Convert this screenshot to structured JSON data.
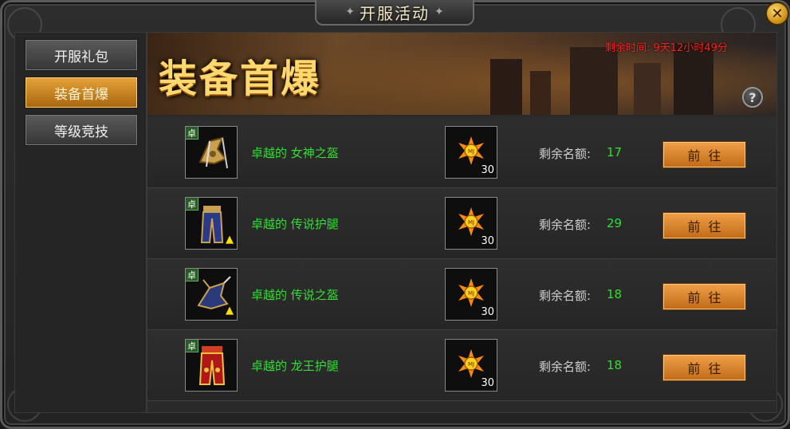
{
  "window": {
    "title": "开服活动"
  },
  "sidebar": {
    "items": [
      {
        "label": "开服礼包"
      },
      {
        "label": "装备首爆"
      },
      {
        "label": "等级竞技"
      }
    ]
  },
  "banner": {
    "title": "装备首爆",
    "countdown": "剩余时间: 9天12小时49分",
    "help": "?"
  },
  "list": {
    "rows": [
      {
        "tag": "卓",
        "name": "卓越的 女神之盔",
        "reward_count": "30",
        "quota_label": "剩余名额:",
        "quota_value": "17",
        "button": "前往",
        "item_icon": "helmet-icon",
        "has_upgrade": false
      },
      {
        "tag": "卓",
        "name": "卓越的 传说护腿",
        "reward_count": "30",
        "quota_label": "剩余名额:",
        "quota_value": "29",
        "button": "前往",
        "item_icon": "leggings-icon",
        "has_upgrade": true
      },
      {
        "tag": "卓",
        "name": "卓越的 传说之盔",
        "reward_count": "30",
        "quota_label": "剩余名额:",
        "quota_value": "18",
        "button": "前往",
        "item_icon": "helmet-icon",
        "has_upgrade": true
      },
      {
        "tag": "卓",
        "name": "卓越的 龙王护腿",
        "reward_count": "30",
        "quota_label": "剩余名额:",
        "quota_value": "18",
        "button": "前往",
        "item_icon": "leggings-icon",
        "has_upgrade": false
      }
    ]
  },
  "colors": {
    "accent_orange": "#e6a33a",
    "green_text": "#33dd33",
    "countdown_red": "#ff2020",
    "banner_gold": "#ffd870"
  }
}
